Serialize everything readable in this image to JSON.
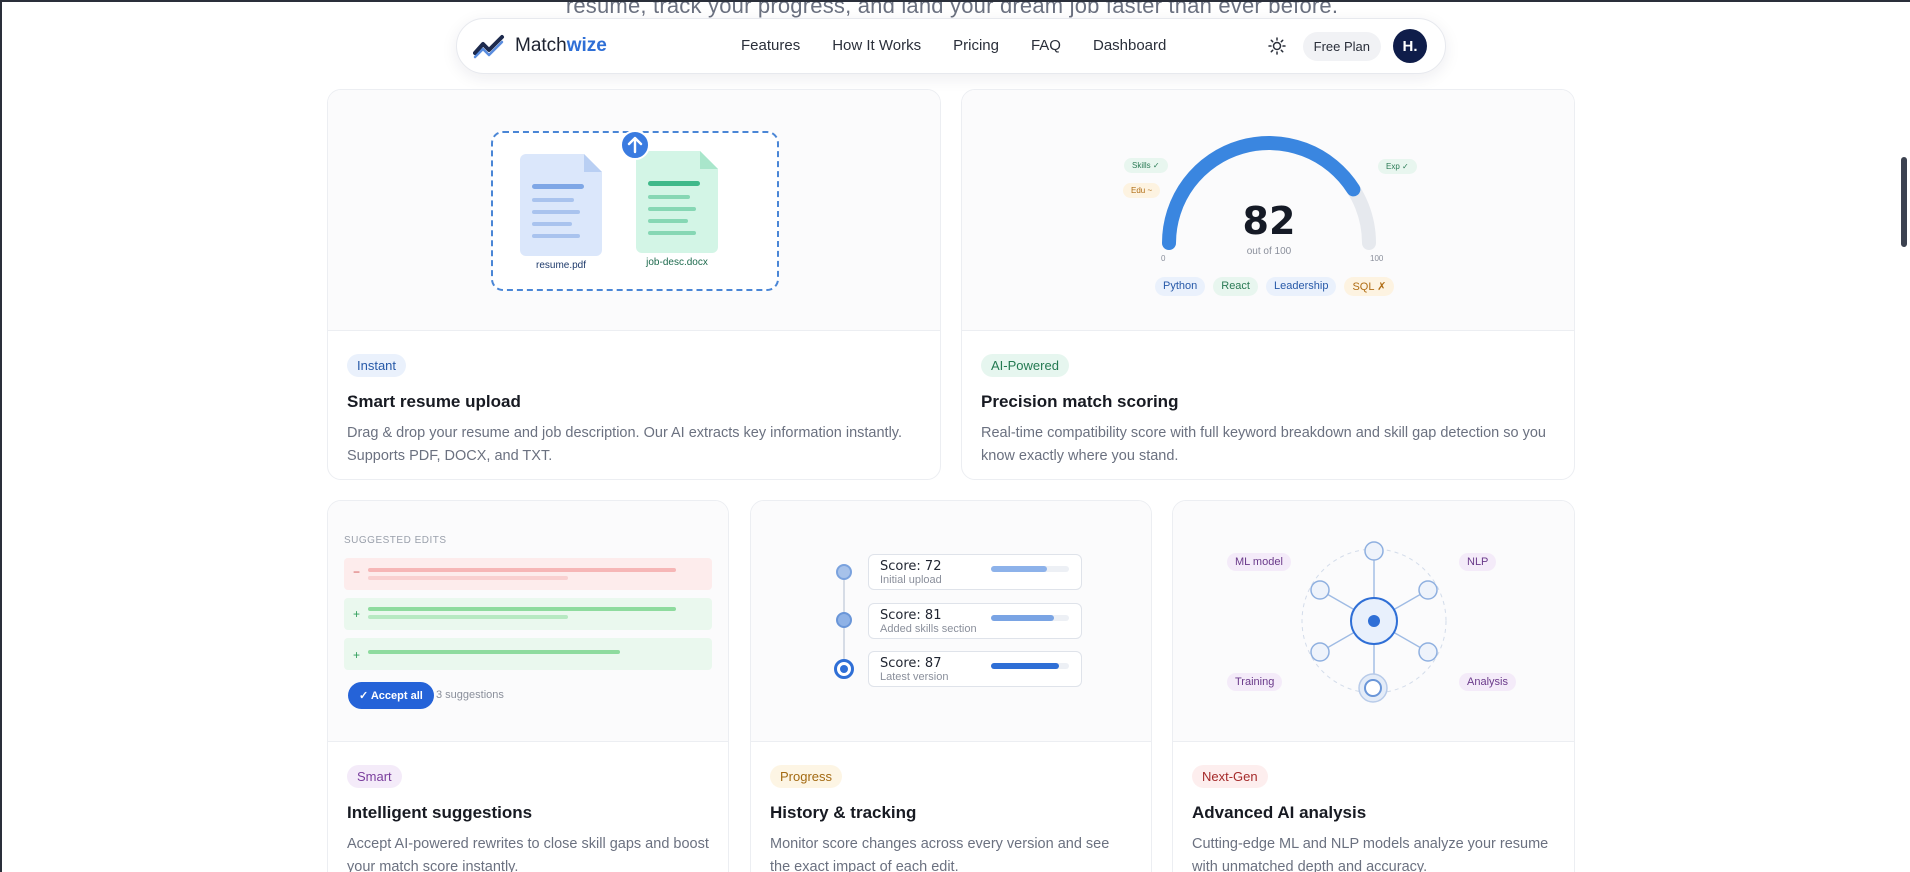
{
  "hero": {
    "text": "resume, track your progress, and land your dream job faster than ever before."
  },
  "nav": {
    "brand_plain": "Match",
    "brand_accent": "wize",
    "logo_icon": "trend-line-logo-icon",
    "links": [
      "Features",
      "How It Works",
      "Pricing",
      "FAQ",
      "Dashboard"
    ],
    "theme_icon": "sun-icon",
    "plan": "Free Plan",
    "avatar": "H."
  },
  "cards": {
    "upload": {
      "badge": "Instant",
      "title": "Smart resume upload",
      "desc": "Drag & drop your resume and job description. Our AI extracts key information instantly. Supports PDF, DOCX, and TXT.",
      "file1": "resume.pdf",
      "file2": "job-desc.docx"
    },
    "scoring": {
      "badge": "AI-Powered",
      "title": "Precision match scoring",
      "desc": "Real-time compatibility score with full keyword breakdown and skill gap detection so you know exactly where you stand.",
      "score": "82",
      "score_fraction": 0.82,
      "score_sub": "out of 100",
      "min": "0",
      "max": "100",
      "tag_skills": "Skills ✓",
      "tag_edu": "Edu ~",
      "tag_exp": "Exp ✓",
      "keywords": [
        "Python",
        "React",
        "Leadership",
        "SQL ✗"
      ]
    },
    "suggestions": {
      "badge": "Smart",
      "title": "Intelligent suggestions",
      "desc": "Accept AI-powered rewrites to close skill gaps and boost your match score instantly.",
      "heading": "SUGGESTED EDITS",
      "minus": "−",
      "plus": "+",
      "accept": "✓ Accept all",
      "count": "3 suggestions"
    },
    "history": {
      "badge": "Progress",
      "title": "History & tracking",
      "desc": "Monitor score changes across every version and see the exact impact of each edit.",
      "items": [
        {
          "score": "Score: 72",
          "label": "Initial upload",
          "fill": 0.72
        },
        {
          "score": "Score: 81",
          "label": "Added skills section",
          "fill": 0.81
        },
        {
          "score": "Score: 87",
          "label": "Latest version",
          "fill": 0.87
        }
      ]
    },
    "analysis": {
      "badge": "Next-Gen",
      "title": "Advanced AI analysis",
      "desc": "Cutting-edge ML and NLP models analyze your resume with unmatched depth and accuracy.",
      "labels": [
        "ML model",
        "NLP",
        "Training",
        "Analysis"
      ]
    }
  },
  "colors": {
    "accent": "#2f6fd6",
    "navy": "#0f1d4a",
    "green": "#2f9e6e",
    "purple": "#7a3e9d",
    "amber": "#b7791f",
    "red": "#b83232"
  }
}
